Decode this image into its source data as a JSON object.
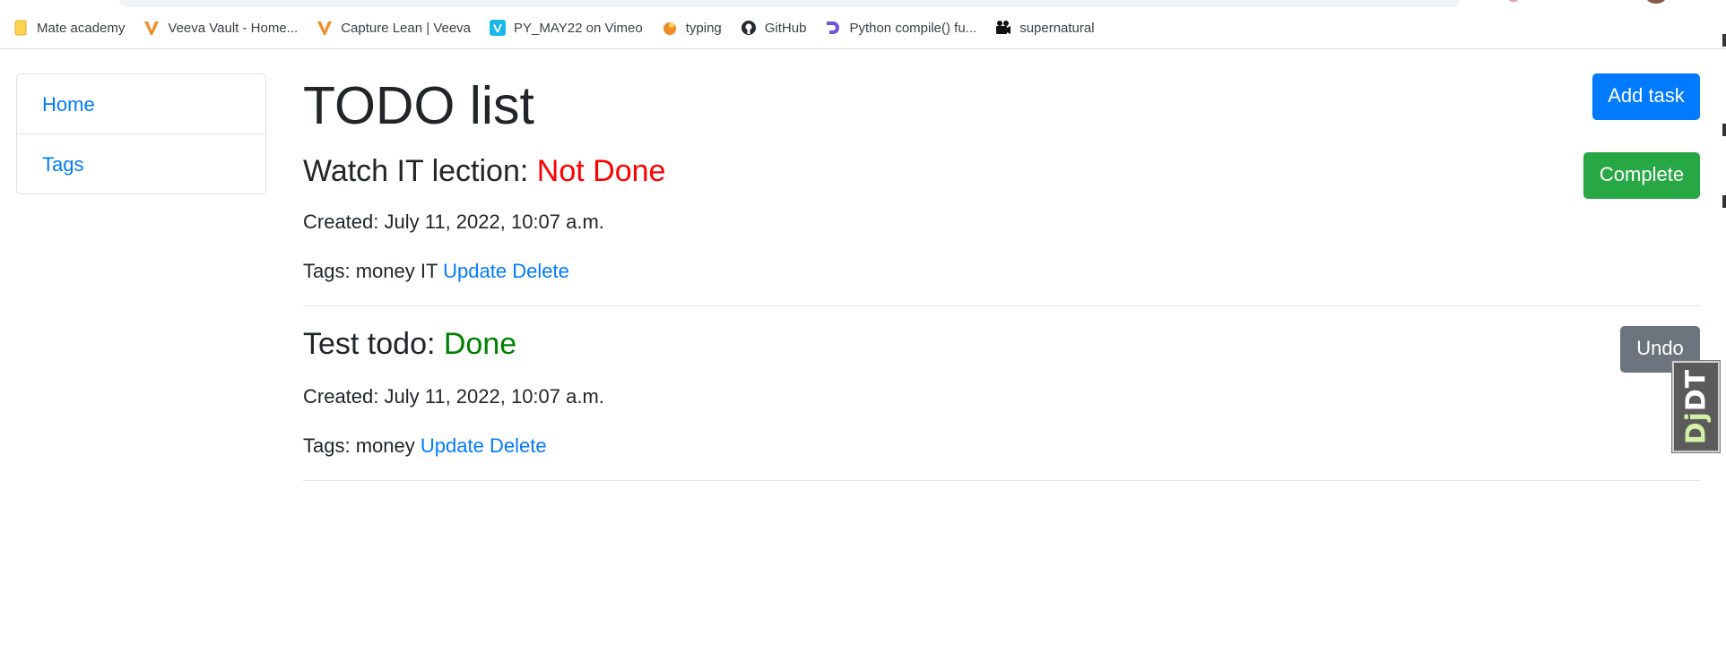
{
  "bookmarks": [
    {
      "label": "Mate academy",
      "icon": "folder-icon"
    },
    {
      "label": "Veeva Vault - Home...",
      "icon": "veeva-logo-icon"
    },
    {
      "label": "Capture Lean | Veeva",
      "icon": "veeva-logo-icon"
    },
    {
      "label": "PY_MAY22 on Vimeo",
      "icon": "vimeo-logo-icon"
    },
    {
      "label": "typing",
      "icon": "typing-logo-icon"
    },
    {
      "label": "GitHub",
      "icon": "github-logo-icon"
    },
    {
      "label": "Python compile() fu...",
      "icon": "python-site-logo-icon"
    },
    {
      "label": "supernatural",
      "icon": "film-camera-icon"
    }
  ],
  "sidebar": {
    "items": [
      {
        "label": "Home"
      },
      {
        "label": "Tags"
      }
    ]
  },
  "page": {
    "title": "TODO list",
    "add_task_label": "Add task"
  },
  "tasks": [
    {
      "title": "Watch IT lection:",
      "status": "Not Done",
      "created": "Created: July 11, 2022, 10:07 a.m.",
      "tags_prefix": "Tags:",
      "tags": "money IT",
      "update_label": "Update",
      "delete_label": "Delete",
      "action_label": "Complete"
    },
    {
      "title": "Test todo:",
      "status": "Done",
      "created": "Created: July 11, 2022, 10:07 a.m.",
      "tags_prefix": "Tags:",
      "tags": "money",
      "update_label": "Update",
      "delete_label": "Delete",
      "action_label": "Undo"
    }
  ],
  "debug_toolbar": {
    "prefix": "Dj",
    "suffix": "DT"
  },
  "colors": {
    "primary": "#007bff",
    "success": "#28a745",
    "secondary": "#6c757d",
    "status_not_done": "#ff0000",
    "status_done": "#008000"
  }
}
